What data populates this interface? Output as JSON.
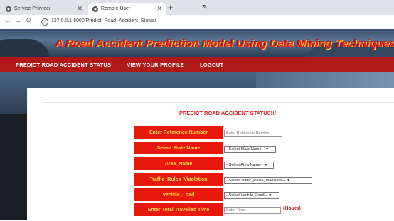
{
  "browser": {
    "tabs": [
      {
        "label": "Service Provider"
      },
      {
        "label": "Remote User"
      }
    ],
    "url": "127.0.0.1:8000/Predict_Road_Accident_Status/"
  },
  "header": {
    "title": "A Road Accident Prediction Model Using Data Mining Techniques"
  },
  "nav": {
    "items": [
      {
        "label": "PREDICT ROAD ACCIDENT STATUS"
      },
      {
        "label": "VIEW YOUR PROFILE"
      },
      {
        "label": "LOGOUT"
      }
    ]
  },
  "form": {
    "title": "PREDICT ROAD ACCIDENT STATUS!!!",
    "fields": [
      {
        "label": "Enter Reference Number",
        "placeholder": "Enter Reference Number"
      },
      {
        "label": "Select State Name",
        "selected": "--Select State Name--"
      },
      {
        "label": "Area_Name",
        "selected": "--Select Area Name--"
      },
      {
        "label": "Traffic_Rules_Viaolation",
        "selected": "--Select Traffic_Rules_Viaolation--"
      },
      {
        "label": "Vechile_Load",
        "selected": "--Select Vechile_Load--"
      },
      {
        "label": "Enter Total Travelled Time",
        "placeholder": "Enter Time",
        "suffix": "(Hours)"
      }
    ]
  },
  "colors": {
    "navbar": "#b01818",
    "label_bg": "#e8190c",
    "label_text": "#ffd84a",
    "title_red": "#d81d1d"
  }
}
